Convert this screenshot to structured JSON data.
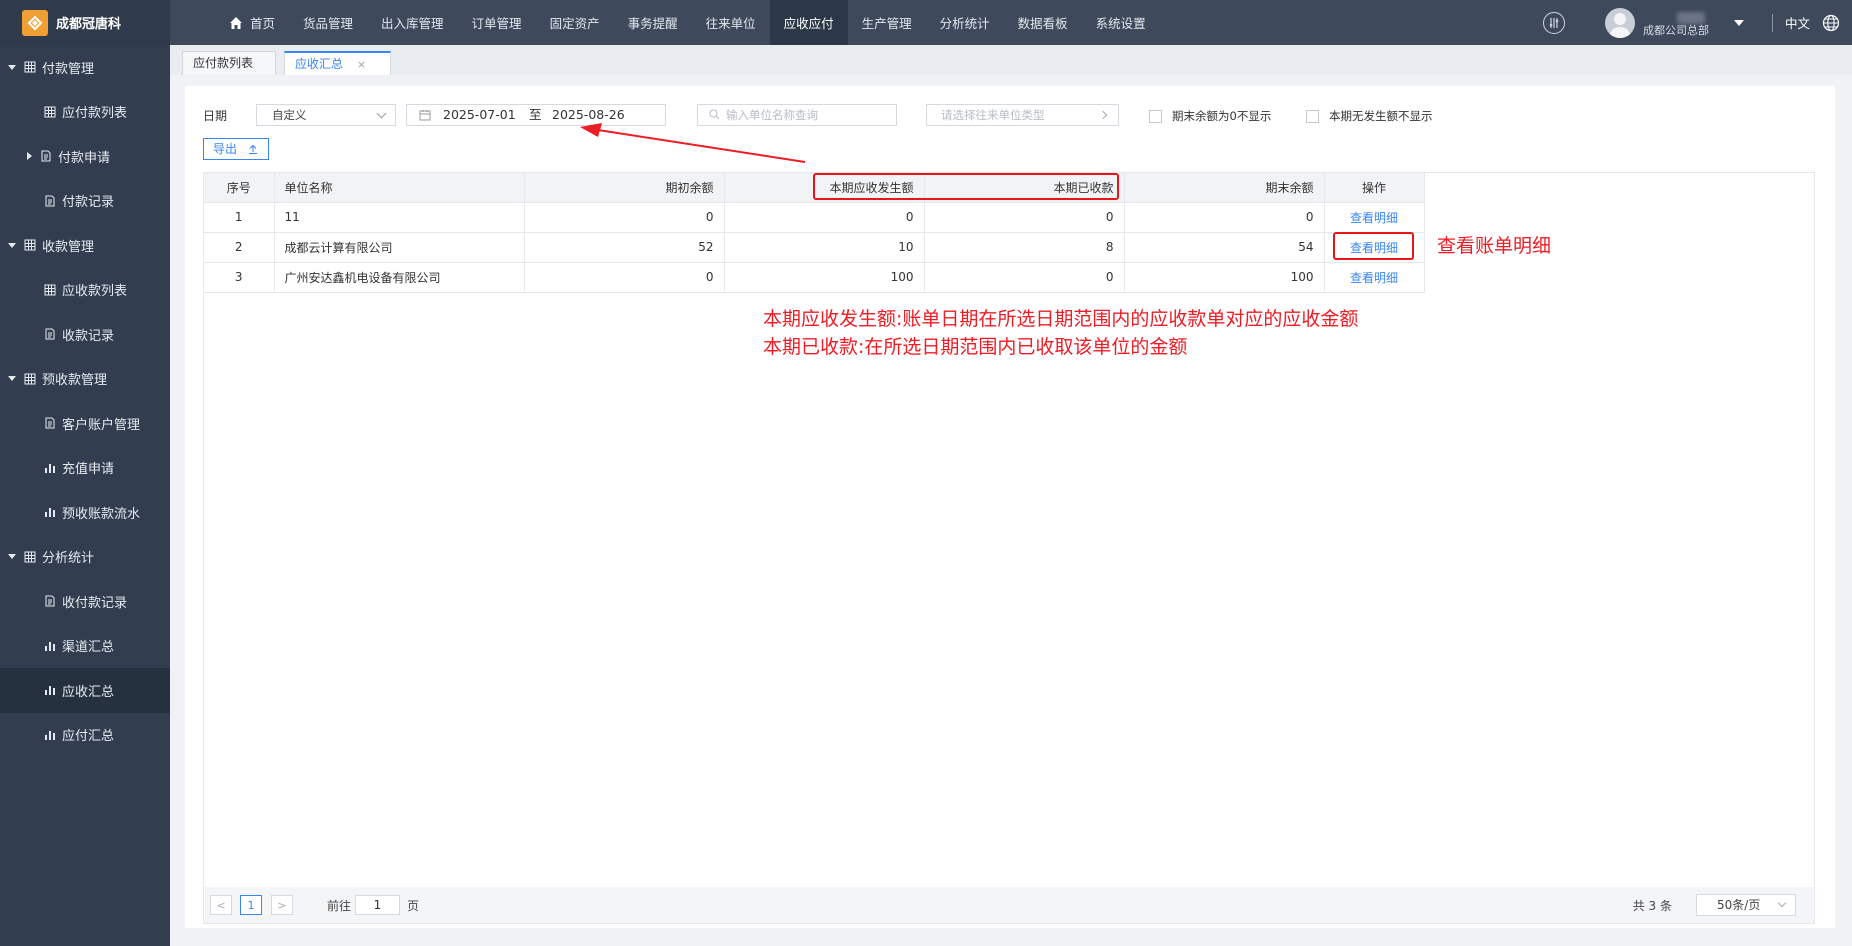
{
  "app": {
    "brand": "成都冠唐科"
  },
  "nav": [
    {
      "label": "首页"
    },
    {
      "label": "货品管理"
    },
    {
      "label": "出入库管理"
    },
    {
      "label": "订单管理"
    },
    {
      "label": "固定资产"
    },
    {
      "label": "事务提醒"
    },
    {
      "label": "往来单位"
    },
    {
      "label": "应收应付"
    },
    {
      "label": "生产管理"
    },
    {
      "label": "分析统计"
    },
    {
      "label": "数据看板"
    },
    {
      "label": "系统设置"
    }
  ],
  "user": {
    "company": "成都公司总部",
    "language": "中文"
  },
  "sidebar": {
    "groups": [
      {
        "label": "付款管理",
        "items": [
          {
            "label": "应付款列表"
          },
          {
            "label": "付款申请"
          },
          {
            "label": "付款记录"
          }
        ]
      },
      {
        "label": "收款管理",
        "items": [
          {
            "label": "应收款列表"
          },
          {
            "label": "收款记录"
          }
        ]
      },
      {
        "label": "预收款管理",
        "items": [
          {
            "label": "客户账户管理"
          },
          {
            "label": "充值申请"
          },
          {
            "label": "预收账款流水"
          }
        ]
      },
      {
        "label": "分析统计",
        "items": [
          {
            "label": "收付款记录"
          },
          {
            "label": "渠道汇总"
          },
          {
            "label": "应收汇总"
          },
          {
            "label": "应付汇总"
          }
        ]
      }
    ]
  },
  "tabs": [
    {
      "label": "应付款列表"
    },
    {
      "label": "应收汇总",
      "close": "×"
    }
  ],
  "filters": {
    "date_label": "日期",
    "date_mode": "自定义",
    "date_start": "2025-07-01",
    "date_sep": "至",
    "date_end": "2025-08-26",
    "search_placeholder": "输入单位名称查询",
    "type_placeholder": "请选择往来单位类型",
    "check_zero_balance": "期末余额为0不显示",
    "check_no_activity": "本期无发生额不显示",
    "export_label": "导出"
  },
  "table": {
    "headers": [
      "序号",
      "单位名称",
      "期初余额",
      "本期应收发生额",
      "本期已收款",
      "期末余额",
      "操作"
    ],
    "rows": [
      {
        "idx": "1",
        "name": "11",
        "opening": "0",
        "receivable": "0",
        "received": "0",
        "closing": "0",
        "action": "查看明细"
      },
      {
        "idx": "2",
        "name": "成都云计算有限公司",
        "opening": "52",
        "receivable": "10",
        "received": "8",
        "closing": "54",
        "action": "查看明细"
      },
      {
        "idx": "3",
        "name": "广州安达鑫机电设备有限公司",
        "opening": "0",
        "receivable": "100",
        "received": "0",
        "closing": "100",
        "action": "查看明细"
      }
    ]
  },
  "pager": {
    "prev": "<",
    "current": "1",
    "next": ">",
    "goto_label": "前往",
    "goto_value": "1",
    "page_unit": "页",
    "total": "共 3 条",
    "page_size": "50条/页"
  },
  "annotations": {
    "detail_note": "查看账单明细",
    "line1": "本期应收发生额:账单日期在所选日期范围内的应收款单对应的应收金额",
    "line2": "本期已收款:在所选日期范围内已收取该单位的金额",
    "color": "#ee1c24"
  }
}
